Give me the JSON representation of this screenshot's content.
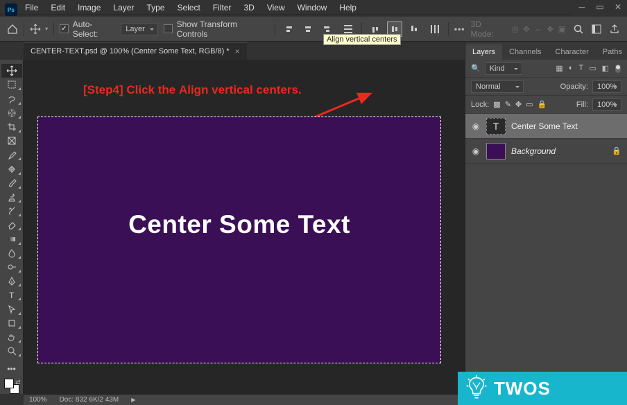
{
  "menubar": [
    "File",
    "Edit",
    "Image",
    "Layer",
    "Type",
    "Select",
    "Filter",
    "3D",
    "View",
    "Window",
    "Help"
  ],
  "options": {
    "auto_select_label": "Auto-Select:",
    "auto_select_target": "Layer",
    "show_transform_label": "Show Transform Controls",
    "mode_label": "3D Mode:"
  },
  "tooltip": "Align vertical centers",
  "tab_title": "CENTER-TEXT.psd @ 100% (Center Some Text, RGB/8) *",
  "instruction_prefix": "[Step4] ",
  "instruction_mid": "Click the ",
  "instruction_bold": "Align vertical centers",
  "instruction_suffix": ".",
  "canvas_text": "Center Some Text",
  "status": {
    "zoom": "100%",
    "doc": "Doc: 832 6K/2 43M"
  },
  "panel_tabs": [
    "Layers",
    "Channels",
    "Character",
    "Paths"
  ],
  "filter_label": "Kind",
  "blend_mode": "Normal",
  "opacity_label": "Opacity:",
  "opacity_value": "100%",
  "lock_label": "Lock:",
  "fill_label": "Fill:",
  "fill_value": "100%",
  "layers": [
    {
      "name": "Center Some Text",
      "type": "text",
      "active": true
    },
    {
      "name": "Background",
      "type": "raster",
      "locked": true
    }
  ],
  "watermark": "TWOS"
}
